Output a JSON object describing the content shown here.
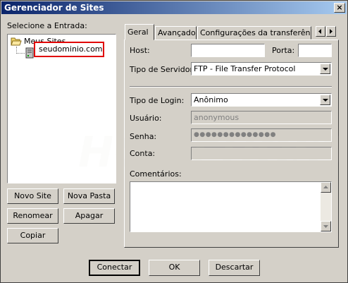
{
  "window": {
    "title": "Gerenciador de Sites",
    "close_glyph": "×"
  },
  "left": {
    "select_label": "Selecione a Entrada:",
    "tree": {
      "root": "Meus Sites",
      "child": "seudominio.com"
    },
    "buttons": {
      "new_site": "Novo Site",
      "new_folder": "Nova Pasta",
      "rename": "Renomear",
      "delete": "Apagar",
      "copy": "Copiar"
    }
  },
  "tabs": [
    {
      "label": "Geral"
    },
    {
      "label": "Avançado"
    },
    {
      "label": "Configurações da transferência"
    }
  ],
  "form": {
    "host_label": "Host:",
    "host_value": "",
    "port_label": "Porta:",
    "port_value": "",
    "server_type_label": "Tipo de Servidor:",
    "server_type_value": "FTP - File Transfer Protocol",
    "login_type_label": "Tipo de Login:",
    "login_type_value": "Anônimo",
    "user_label": "Usuário:",
    "user_value": "anonymous",
    "password_label": "Senha:",
    "password_value": "●●●●●●●●●●●●●●",
    "account_label": "Conta:",
    "account_value": "",
    "comments_label": "Comentários:"
  },
  "footer": {
    "connect": "Conectar",
    "ok": "OK",
    "cancel": "Descartar"
  },
  "watermark": "HOMEHOST",
  "colors": {
    "title_start": "#0a246a",
    "title_end": "#a6caf0",
    "highlight": "#e00000",
    "face": "#d4d0c8"
  }
}
